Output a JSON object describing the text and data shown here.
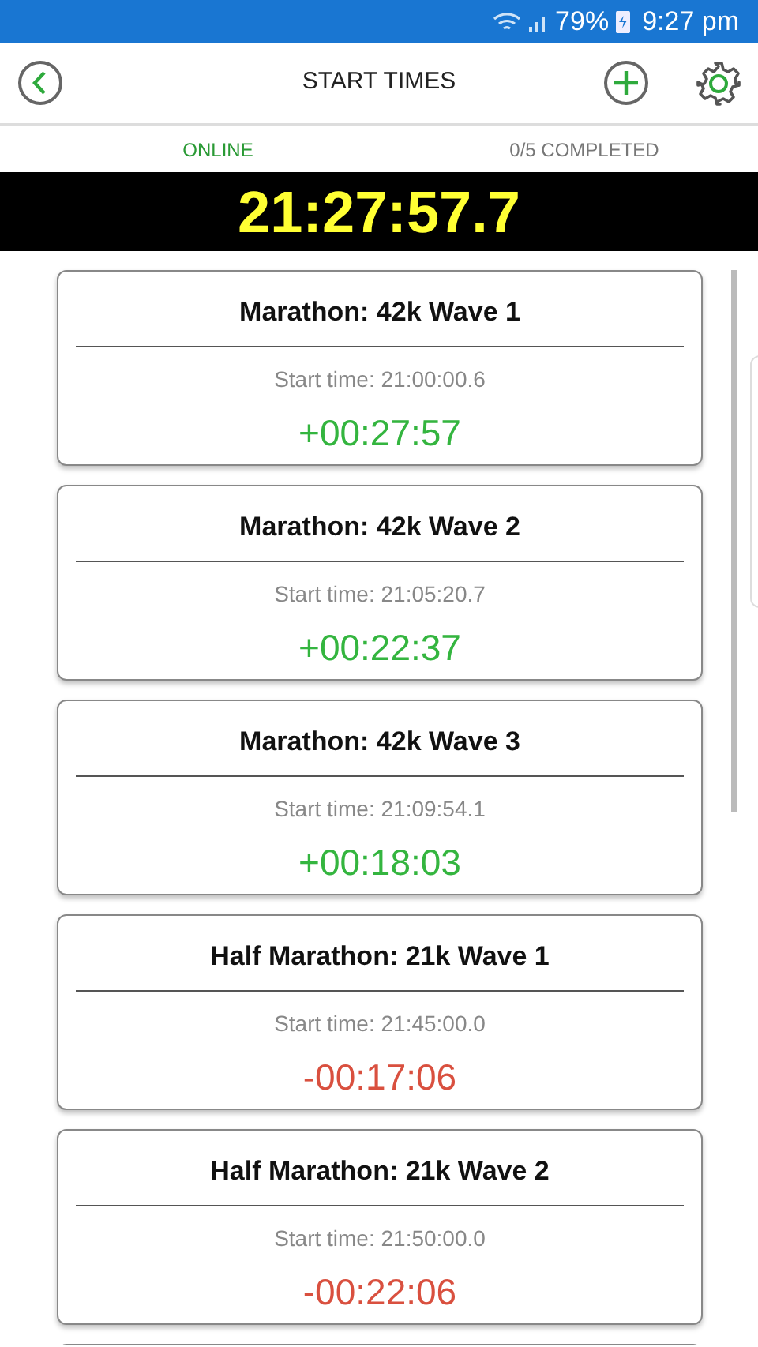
{
  "status_bar": {
    "battery": "79%",
    "time": "9:27 pm"
  },
  "header": {
    "title": "START TIMES"
  },
  "info": {
    "connection": "ONLINE",
    "progress": "0/5 COMPLETED"
  },
  "clock": "21:27:57.7",
  "waves": [
    {
      "name": "Marathon: 42k Wave 1",
      "start": "Start time: 21:00:00.6",
      "offset": "+00:27:57",
      "kind": "started"
    },
    {
      "name": "Marathon: 42k Wave 2",
      "start": "Start time: 21:05:20.7",
      "offset": "+00:22:37",
      "kind": "started"
    },
    {
      "name": "Marathon: 42k Wave 3",
      "start": "Start time: 21:09:54.1",
      "offset": "+00:18:03",
      "kind": "started"
    },
    {
      "name": "Half Marathon: 21k Wave 1",
      "start": "Start time: 21:45:00.0",
      "offset": "-00:17:06",
      "kind": "upcoming"
    },
    {
      "name": "Half Marathon: 21k Wave 2",
      "start": "Start time: 21:50:00.0",
      "offset": "-00:22:06",
      "kind": "upcoming"
    }
  ]
}
